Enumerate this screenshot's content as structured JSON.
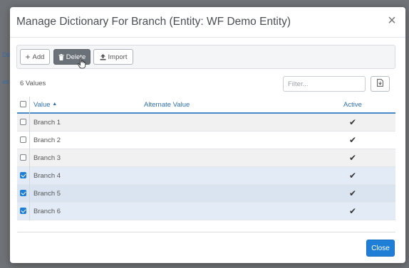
{
  "modal": {
    "title": "Manage Dictionary For Branch (Entity: WF Demo Entity)"
  },
  "toolbar": {
    "add_label": "Add",
    "delete_label": "Delete",
    "import_label": "Import"
  },
  "summary": {
    "count_label": "6 Values"
  },
  "filter": {
    "placeholder": "Filter..."
  },
  "grid": {
    "columns": {
      "value": "Value",
      "alternate_value": "Alternate Value",
      "active": "Active"
    },
    "rows": [
      {
        "value": "Branch 1",
        "alternate_value": "",
        "active": "✔",
        "selected": false
      },
      {
        "value": "Branch 2",
        "alternate_value": "",
        "active": "✔",
        "selected": false
      },
      {
        "value": "Branch 3",
        "alternate_value": "",
        "active": "✔",
        "selected": false
      },
      {
        "value": "Branch 4",
        "alternate_value": "",
        "active": "✔",
        "selected": true
      },
      {
        "value": "Branch 5",
        "alternate_value": "",
        "active": "✔",
        "selected": true
      },
      {
        "value": "Branch 6",
        "alternate_value": "",
        "active": "✔",
        "selected": true
      }
    ]
  },
  "footer": {
    "close_label": "Close"
  },
  "background": {
    "left_fragment_top": "Do",
    "left_fragment_mid": "es"
  },
  "colors": {
    "accent": "#1f7fd6",
    "row_even": "#f1f1f1",
    "row_selected": "#e3ecf6",
    "row_selected_alt": "#d9e4f0"
  }
}
